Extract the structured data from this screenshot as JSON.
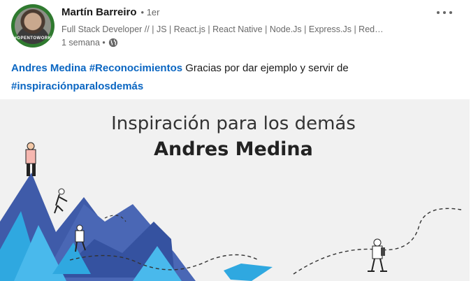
{
  "author": {
    "name": "Martín Barreiro",
    "degree": "• 1er",
    "headline": "Full Stack Developer // | JS | React.js | React Native | Node.Js | Express.Js | Red…",
    "time": "1 semana •",
    "avatar_badge": "#OPENTOWORK"
  },
  "post": {
    "mention": "Andres Medina",
    "hashtag1": "#Reconocimientos",
    "text": " Gracias por dar ejemplo y servir de",
    "hashtag2": "#inspiraciónparalosdemás"
  },
  "media": {
    "title": "Inspiración para los demás",
    "name": "Andres Medina"
  },
  "icons": {
    "globe": "globe-icon",
    "more": "ellipsis-icon"
  },
  "colors": {
    "link": "#0a66c2",
    "mountain_dark": "#3f5ba9",
    "mountain_light": "#2fa8e0",
    "media_bg": "#f1f1f1"
  }
}
